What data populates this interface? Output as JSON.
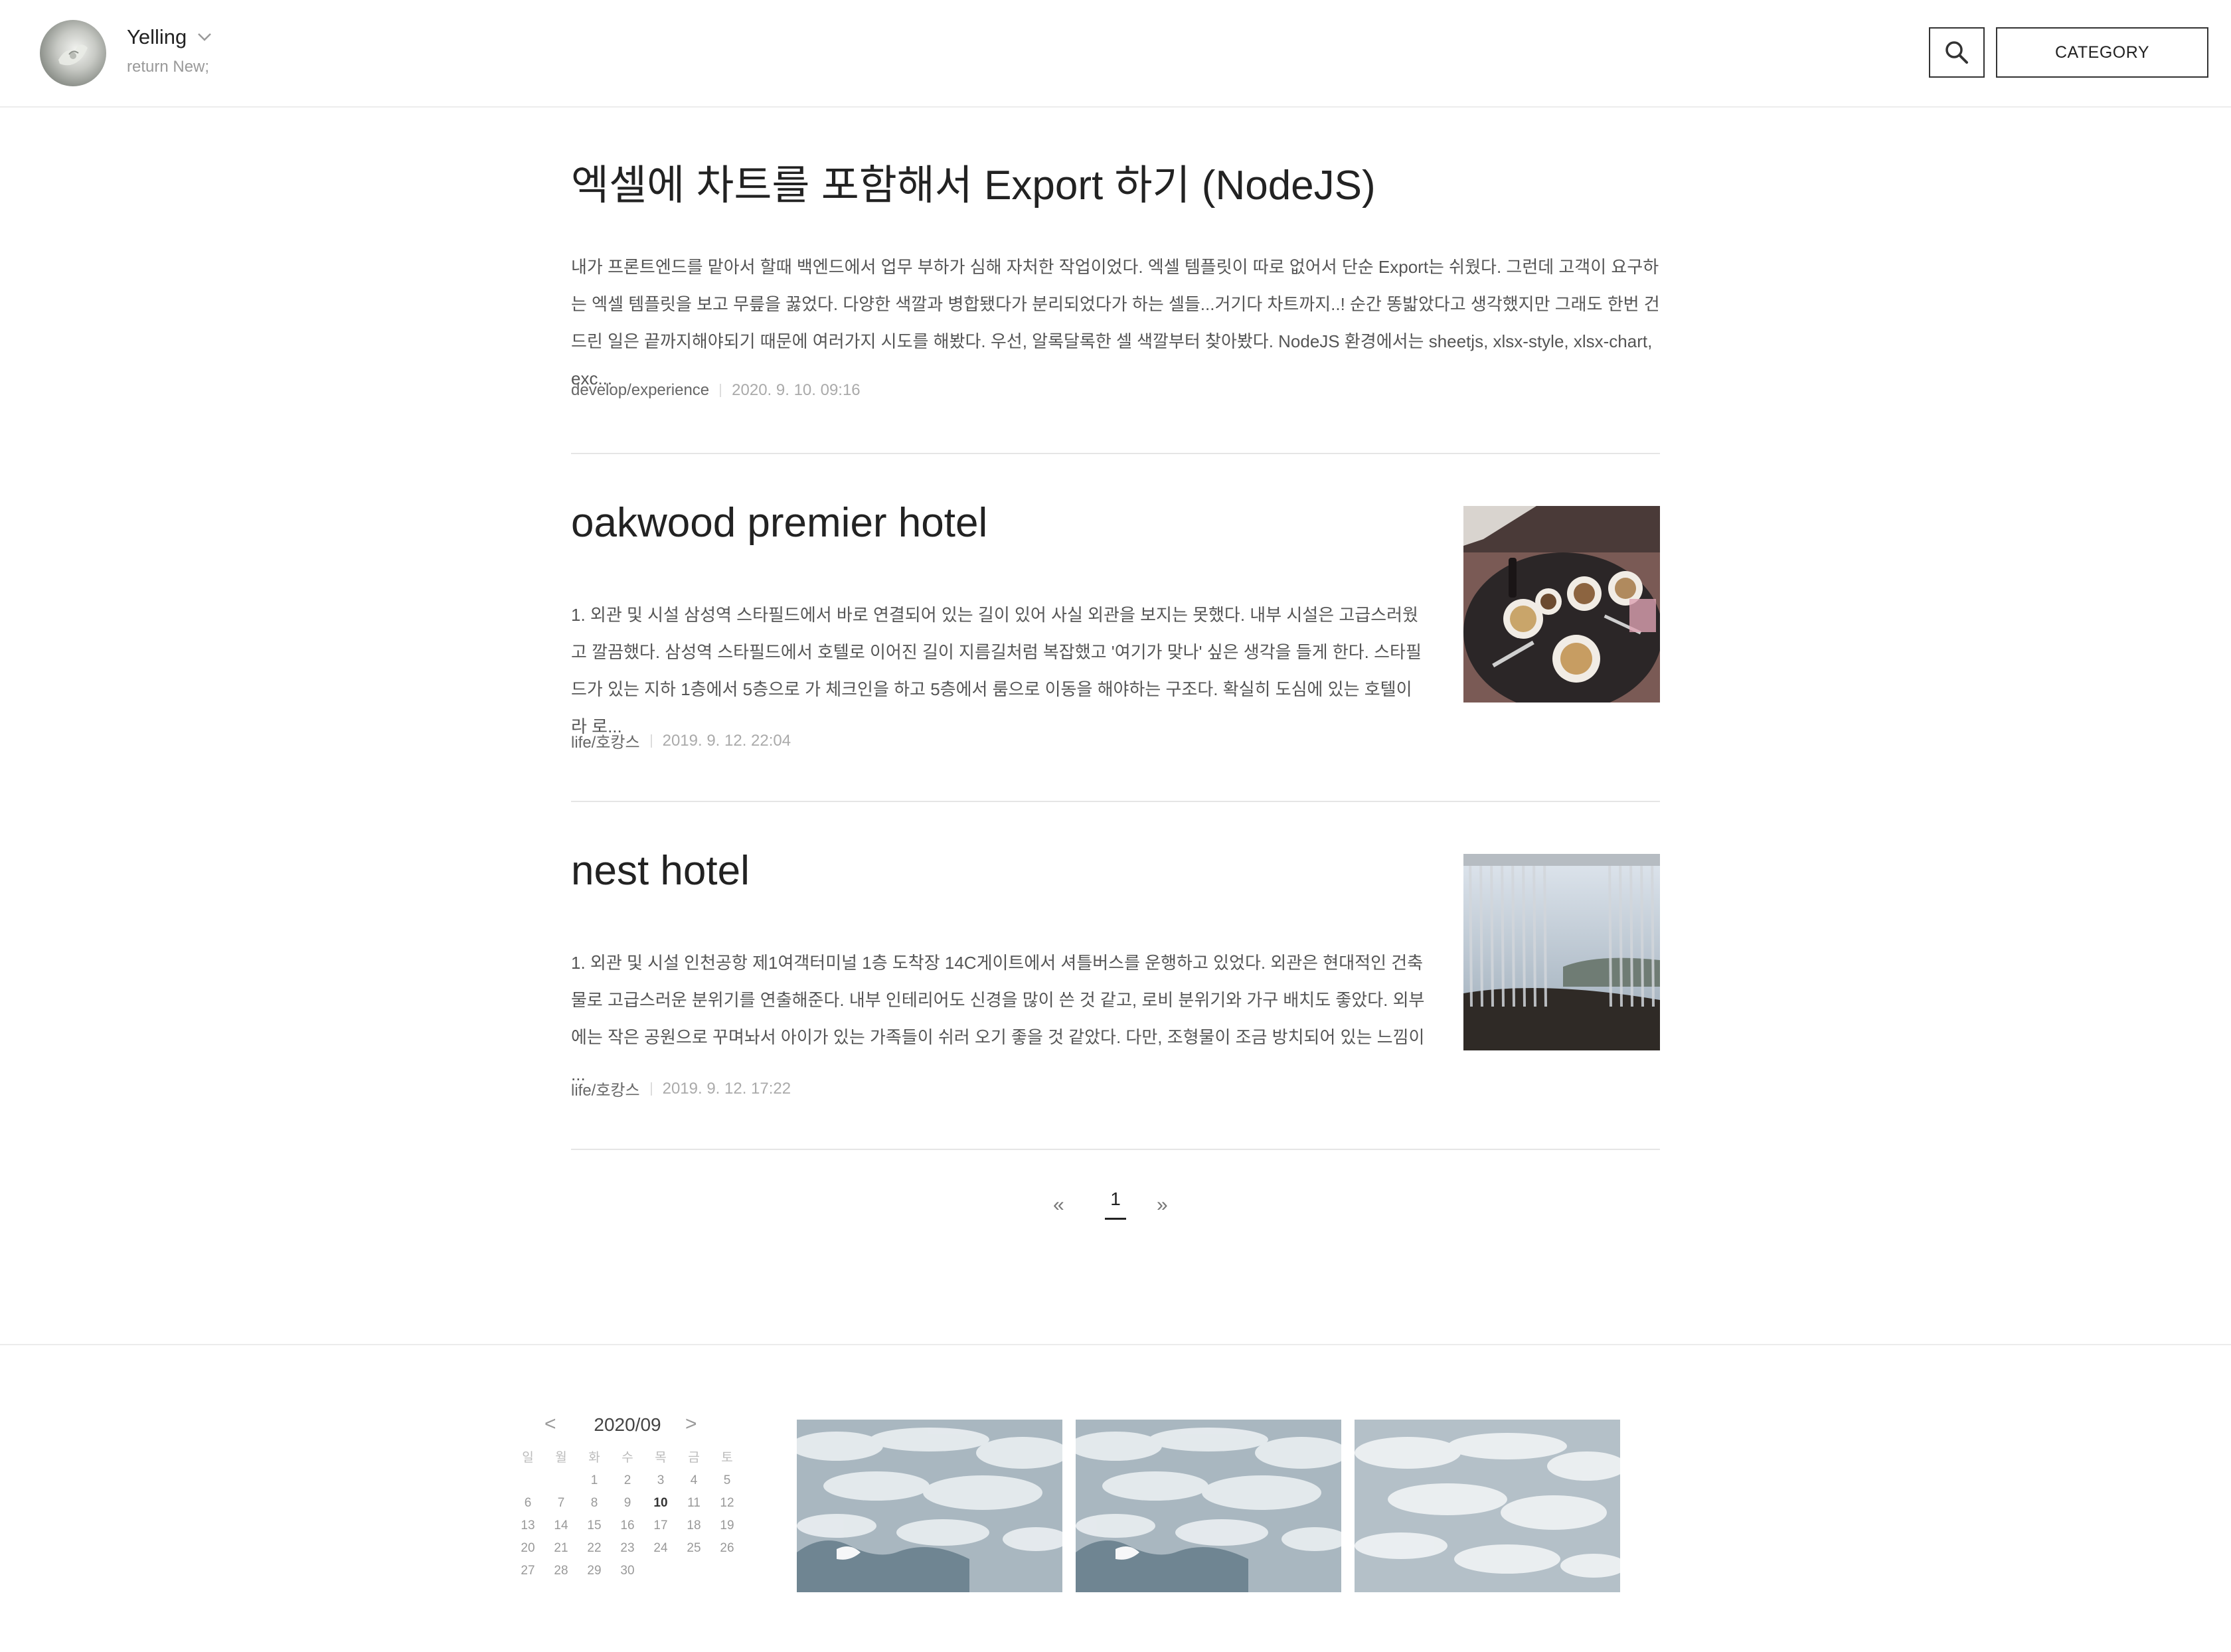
{
  "header": {
    "blog_name": "Yelling",
    "blog_desc": "return New;",
    "category_label": "CATEGORY",
    "icons": {
      "search": "search-icon",
      "dropdown": "chevron-down-icon"
    }
  },
  "posts": [
    {
      "title": "엑셀에 차트를 포함해서 Export 하기 (NodeJS)",
      "excerpt": "내가 프론트엔드를 맡아서 할때 백엔드에서 업무 부하가 심해 자처한 작업이었다. 엑셀 템플릿이 따로 없어서 단순 Export는 쉬웠다. 그런데 고객이 요구하는 엑셀 템플릿을 보고 무릎을 꿇었다. 다양한 색깔과 병합됐다가 분리되었다가 하는 셀들...거기다 차트까지..! 순간 똥밟았다고 생각했지만 그래도 한번 건드린 일은 끝까지해야되기 때문에 여러가지 시도를 해봤다. 우선, 알록달록한 셀 색깔부터 찾아봤다. NodeJS 환경에서는 sheetjs, xlsx-style, xlsx-chart, exc...",
      "category": "develop/experience",
      "date": "2020. 9. 10. 09:16"
    },
    {
      "title": "oakwood premier hotel",
      "excerpt": "1. 외관 및 시설 삼성역 스타필드에서 바로 연결되어 있는 길이 있어 사실 외관을 보지는 못했다. 내부 시설은 고급스러웠고 깔끔했다. 삼성역 스타필드에서 호텔로 이어진 길이 지름길처럼 복잡했고 '여기가 맞나' 싶은 생각을 들게 한다. 스타필드가 있는 지하 1층에서 5층으로 가 체크인을 하고 5층에서 룸으로 이동을 해야하는 구조다. 확실히 도심에 있는 호텔이라 로...",
      "category": "life/호캉스",
      "date": "2019. 9. 12. 22:04"
    },
    {
      "title": "nest hotel",
      "excerpt": "1. 외관 및 시설 인천공항 제1여객터미널 1층 도착장 14C게이트에서 셔틀버스를 운행하고 있었다. 외관은 현대적인 건축물로 고급스러운 분위기를 연출해준다. 내부 인테리어도 신경을 많이 쓴 것 같고, 로비 분위기와 가구 배치도 좋았다. 외부에는 작은 공원으로 꾸며놔서 아이가 있는 가족들이 쉬러 오기 좋을 것 같았다. 다만, 조형물이 조금 방치되어 있는 느낌이 ...",
      "category": "life/호캉스",
      "date": "2019. 9. 12. 17:22"
    }
  ],
  "pagination": {
    "prev": "«",
    "current": "1",
    "next": "»"
  },
  "calendar": {
    "title": "2020/09",
    "prev": "<",
    "next": ">",
    "weekdays": [
      "일",
      "월",
      "화",
      "수",
      "목",
      "금",
      "토"
    ],
    "days": [
      "",
      "",
      "1",
      "2",
      "3",
      "4",
      "5",
      "6",
      "7",
      "8",
      "9",
      "10",
      "11",
      "12",
      "13",
      "14",
      "15",
      "16",
      "17",
      "18",
      "19",
      "20",
      "21",
      "22",
      "23",
      "24",
      "25",
      "26",
      "27",
      "28",
      "29",
      "30",
      "",
      "",
      ""
    ],
    "today": "10"
  }
}
